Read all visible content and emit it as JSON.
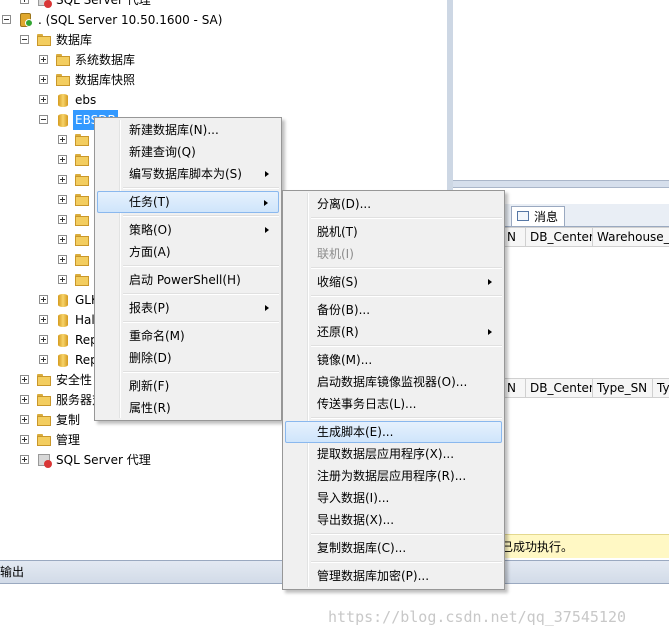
{
  "tree": {
    "top_partial": "SQL Server 代理",
    "server": ". (SQL Server 10.50.1600 - SA)",
    "databases": "数据库",
    "system_dbs": "系统数据库",
    "snapshots": "数据库快照",
    "db_ebs": "ebs",
    "db_selected": "EBSDB",
    "db_glk": "GLK",
    "db_hal": "Hal",
    "db_rep1": "Rep",
    "db_rep2": "Rep",
    "security": "安全性",
    "server_objects": "服务器对象",
    "replication": "复制",
    "management": "管理",
    "agent": "SQL Server 代理"
  },
  "menu1": {
    "new_database": "新建数据库(N)...",
    "new_query": "新建查询(Q)",
    "script_as": "编写数据库脚本为(S)",
    "tasks": "任务(T)",
    "policies": "策略(O)",
    "facets": "方面(A)",
    "powershell": "启动 PowerShell(H)",
    "reports": "报表(P)",
    "rename": "重命名(M)",
    "delete": "删除(D)",
    "refresh": "刷新(F)",
    "properties": "属性(R)"
  },
  "menu2": {
    "detach": "分离(D)...",
    "offline": "脱机(T)",
    "online": "联机(I)",
    "shrink": "收缩(S)",
    "backup": "备份(B)...",
    "restore": "还原(R)",
    "mirror": "镜像(M)...",
    "launch_mirror_monitor": "启动数据库镜像监视器(O)...",
    "ship_logs": "传送事务日志(L)...",
    "generate_scripts": "生成脚本(E)...",
    "extract_dac": "提取数据层应用程序(X)...",
    "register_dac": "注册为数据层应用程序(R)...",
    "import_data": "导入数据(I)...",
    "export_data": "导出数据(X)...",
    "copy_database": "复制数据库(C)...",
    "manage_encryption": "管理数据库加密(P)..."
  },
  "results": {
    "tab_messages": "消息",
    "grid1": [
      "N",
      "DB_Center",
      "Warehouse_SN"
    ],
    "grid2": [
      "N",
      "DB_Center",
      "Type_SN",
      "Typ"
    ],
    "status": "已成功执行。"
  },
  "output": {
    "title": "输出"
  },
  "watermark": "https://blog.csdn.net/qq_37545120",
  "colors": {
    "selection": "#3399ff",
    "menu_highlight": "#cfe5fb",
    "status_bg": "#fff8c4"
  }
}
